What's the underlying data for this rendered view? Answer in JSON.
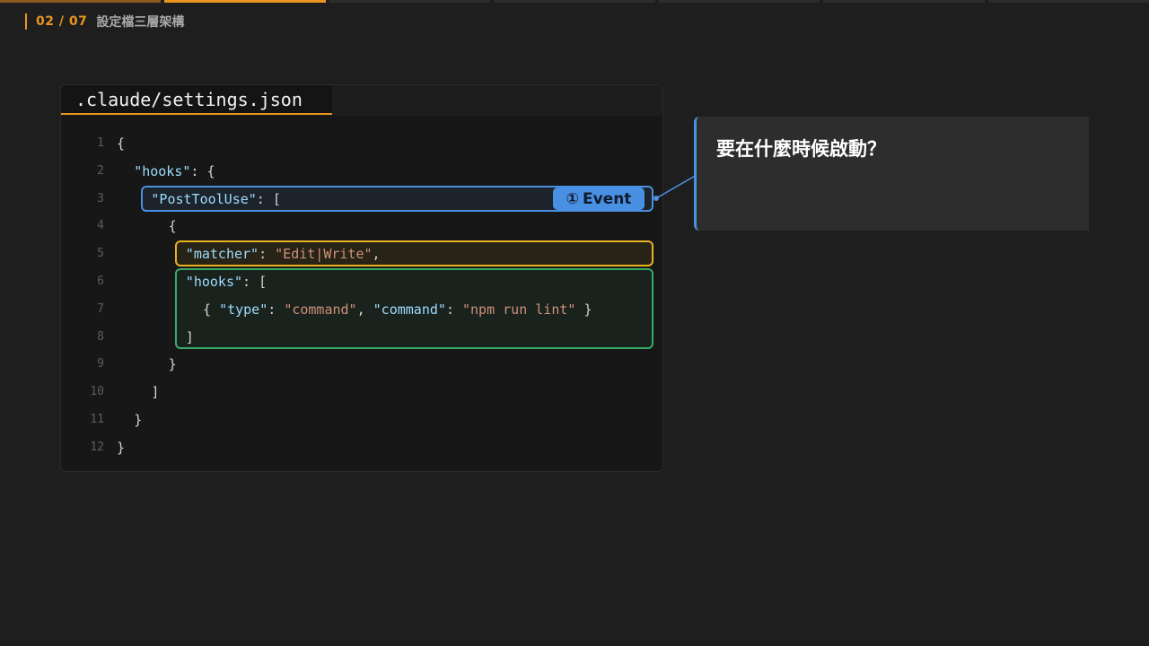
{
  "progress": {
    "total": 7,
    "current": 2
  },
  "header": {
    "counter": "02 / 07",
    "topic": "設定檔三層架構"
  },
  "editor": {
    "file_tab": ".claude/settings.json",
    "lines": [
      {
        "n": "1",
        "indent": 0,
        "tokens": [
          {
            "t": "punc",
            "v": "{"
          }
        ]
      },
      {
        "n": "2",
        "indent": 2,
        "tokens": [
          {
            "t": "key",
            "v": "\"hooks\""
          },
          {
            "t": "punc",
            "v": ": {"
          }
        ]
      },
      {
        "n": "3",
        "indent": 4,
        "tokens": [
          {
            "t": "key",
            "v": "\"PostToolUse\""
          },
          {
            "t": "punc",
            "v": ": ["
          }
        ]
      },
      {
        "n": "4",
        "indent": 6,
        "tokens": [
          {
            "t": "punc",
            "v": "{"
          }
        ]
      },
      {
        "n": "5",
        "indent": 8,
        "tokens": [
          {
            "t": "key",
            "v": "\"matcher\""
          },
          {
            "t": "punc",
            "v": ": "
          },
          {
            "t": "str",
            "v": "\"Edit|Write\""
          },
          {
            "t": "punc",
            "v": ","
          }
        ]
      },
      {
        "n": "6",
        "indent": 8,
        "tokens": [
          {
            "t": "key",
            "v": "\"hooks\""
          },
          {
            "t": "punc",
            "v": ": ["
          }
        ]
      },
      {
        "n": "7",
        "indent": 10,
        "tokens": [
          {
            "t": "punc",
            "v": "{ "
          },
          {
            "t": "key",
            "v": "\"type\""
          },
          {
            "t": "punc",
            "v": ": "
          },
          {
            "t": "str",
            "v": "\"command\""
          },
          {
            "t": "punc",
            "v": ", "
          },
          {
            "t": "key",
            "v": "\"command\""
          },
          {
            "t": "punc",
            "v": ": "
          },
          {
            "t": "str",
            "v": "\"npm run lint\""
          },
          {
            "t": "punc",
            "v": " }"
          }
        ]
      },
      {
        "n": "8",
        "indent": 8,
        "tokens": [
          {
            "t": "punc",
            "v": "]"
          }
        ]
      },
      {
        "n": "9",
        "indent": 6,
        "tokens": [
          {
            "t": "punc",
            "v": "}"
          }
        ]
      },
      {
        "n": "10",
        "indent": 4,
        "tokens": [
          {
            "t": "punc",
            "v": "]"
          }
        ]
      },
      {
        "n": "11",
        "indent": 2,
        "tokens": [
          {
            "t": "punc",
            "v": "}"
          }
        ]
      },
      {
        "n": "12",
        "indent": 0,
        "tokens": [
          {
            "t": "punc",
            "v": "}"
          }
        ]
      }
    ],
    "event_badge": {
      "number": "①",
      "label": "Event"
    }
  },
  "callout": {
    "title": "要在什麼時候啟動？"
  },
  "colors": {
    "accent_orange": "#e8941f",
    "event_blue": "#4a90e2",
    "matcher_yellow": "#e8b21f",
    "hooks_green": "#3aaa6a"
  }
}
